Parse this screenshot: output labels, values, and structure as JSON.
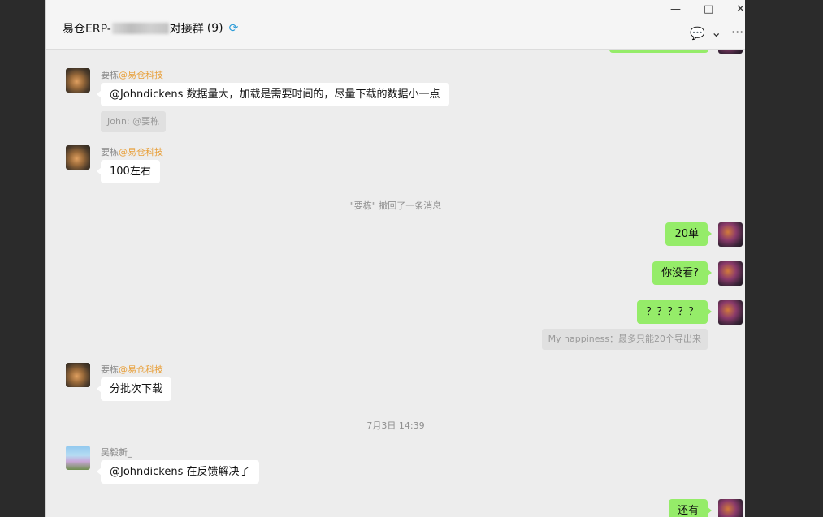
{
  "window": {
    "title_prefix": "易仓ERP-",
    "title_suffix": "对接群",
    "member_count": "(9)",
    "controls": {
      "minimize": "—",
      "maximize": "□",
      "close": "✕"
    },
    "icons": {
      "chat": "💬",
      "chevron": "⌄",
      "more": "···",
      "loop": "⟳"
    }
  },
  "messages": {
    "m1": {
      "sender": "要栋",
      "org": "@易仓科技",
      "text": "@Johndickens 数据量大，加载是需要时间的，尽量下载的数据小一点",
      "quote": "John: @要栋"
    },
    "m2": {
      "sender": "要栋",
      "org": "@易仓科技",
      "text": "100左右"
    },
    "recall": "\"要栋\" 撤回了一条消息",
    "r1": {
      "text": "20单"
    },
    "r2": {
      "text": "你没看?"
    },
    "r3": {
      "text": "？？？？？",
      "quote": "My happiness：最多只能20个导出来"
    },
    "m3": {
      "sender": "要栋",
      "org": "@易仓科技",
      "text": "分批次下载"
    },
    "timestamp": "7月3日 14:39",
    "m4": {
      "sender": "吴毅新_",
      "text": "@Johndickens 在反馈解决了"
    },
    "r4": {
      "text": "还有"
    }
  },
  "colors": {
    "self_bubble": "#95ec69",
    "other_bubble": "#ffffff",
    "org_tag": "#e8a03b",
    "chat_bg": "#ededed"
  }
}
